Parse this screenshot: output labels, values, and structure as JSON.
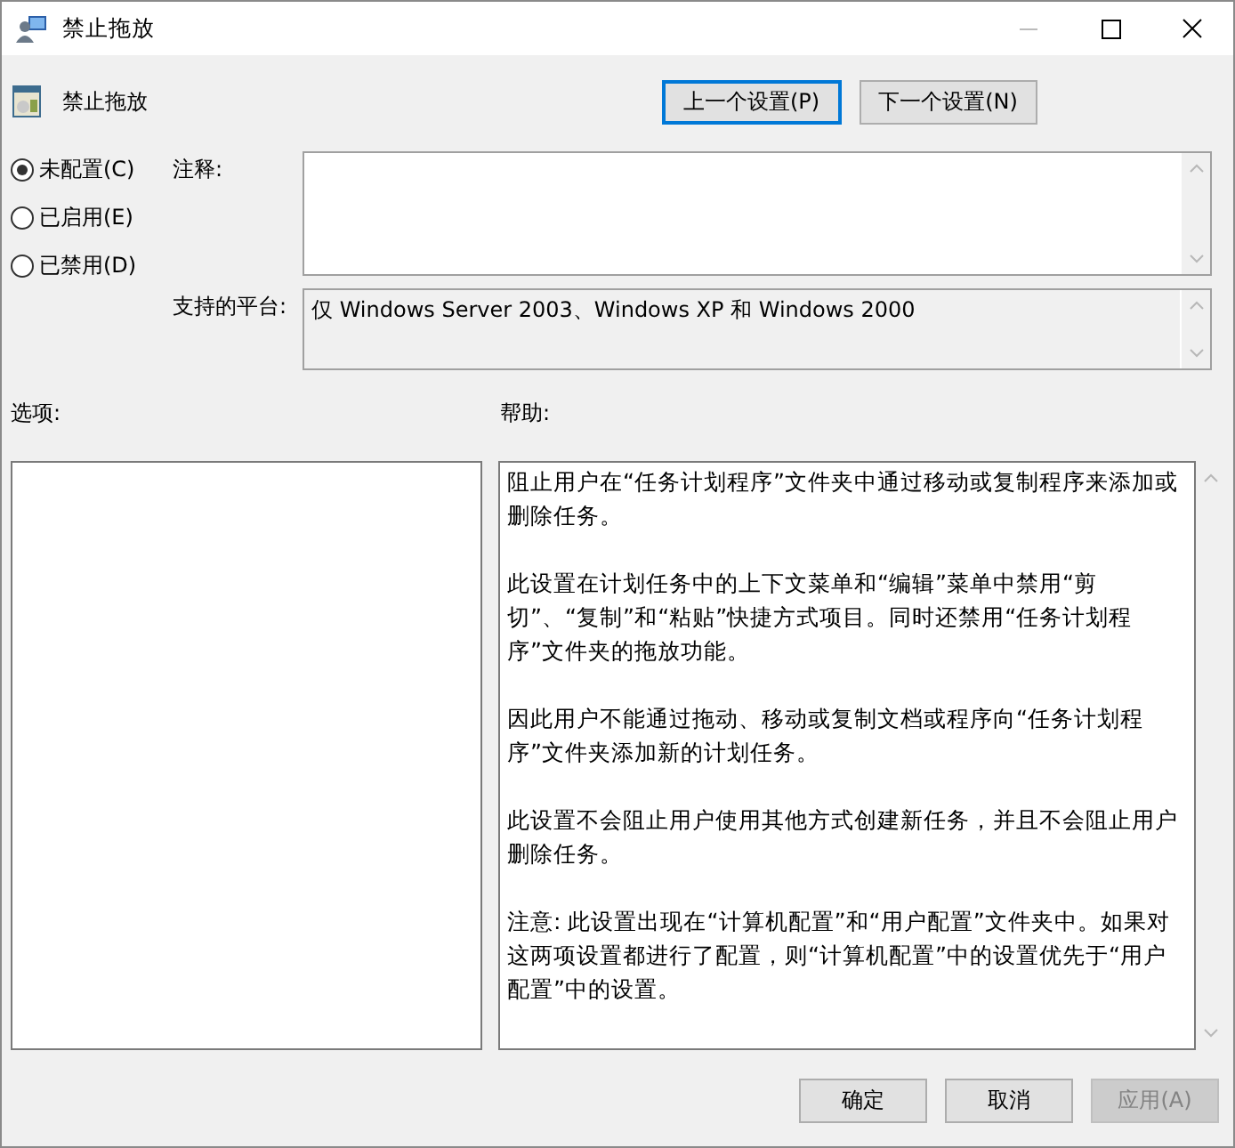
{
  "window": {
    "title": "禁止拖放"
  },
  "setting": {
    "title": "禁止拖放"
  },
  "nav_buttons": [
    {
      "label": "上一个设置(P)",
      "focused": true
    },
    {
      "label": "下一个设置(N)",
      "focused": false
    }
  ],
  "options": [
    {
      "label": "未配置(C)",
      "selected": true
    },
    {
      "label": "已启用(E)",
      "selected": false
    },
    {
      "label": "已禁用(D)",
      "selected": false
    }
  ],
  "comment": {
    "label": "注释:"
  },
  "platform": {
    "label": "支持的平台:",
    "value": "仅 Windows Server 2003、Windows XP 和 Windows 2000"
  },
  "options_panel": {
    "label": "选项:"
  },
  "help": {
    "label": "帮助:",
    "paragraphs": [
      "阻止用户在“任务计划程序”文件夹中通过移动或复制程序来添加或删除任务。",
      "此设置在计划任务中的上下文菜单和“编辑”菜单中禁用“剪切”、“复制”和“粘贴”快捷方式项目。同时还禁用“任务计划程序”文件夹的拖放功能。",
      "因此用户不能通过拖动、移动或复制文档或程序向“任务计划程序”文件夹添加新的计划任务。",
      "此设置不会阻止用户使用其他方式创建新任务，并且不会阻止用户删除任务。",
      "注意: 此设置出现在“计算机配置”和“用户配置”文件夹中。如果对这两项设置都进行了配置，则“计算机配置”中的设置优先于“用户配置”中的设置。"
    ]
  },
  "buttons": [
    {
      "label": "确定",
      "disabled": false
    },
    {
      "label": "取消",
      "disabled": false
    },
    {
      "label": "应用(A)",
      "disabled": true
    }
  ]
}
